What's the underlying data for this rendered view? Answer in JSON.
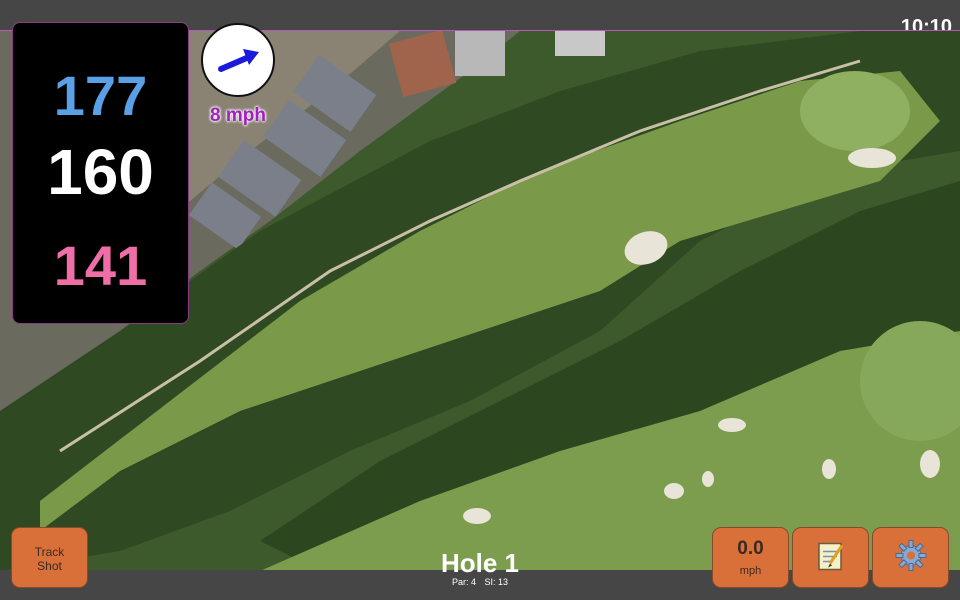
{
  "status_bar": {
    "time": "10:10"
  },
  "distances": {
    "back": "177",
    "center": "160",
    "front": "141"
  },
  "wind": {
    "speed_label": "8 mph",
    "icon": "wind-arrow-icon"
  },
  "hole": {
    "title": "Hole 1",
    "par": "Par: 4",
    "stroke_index": "SI: 13"
  },
  "buttons": {
    "track_shot": "Track\nShot",
    "speed_value": "0.0",
    "speed_unit": "mph",
    "notes_icon": "notepad-icon",
    "settings_icon": "gear-icon"
  },
  "colors": {
    "back": "#5aa0e6",
    "center": "#ffffff",
    "front": "#f06ea8",
    "button": "#d9703a",
    "wind_text": "#a020c0"
  }
}
